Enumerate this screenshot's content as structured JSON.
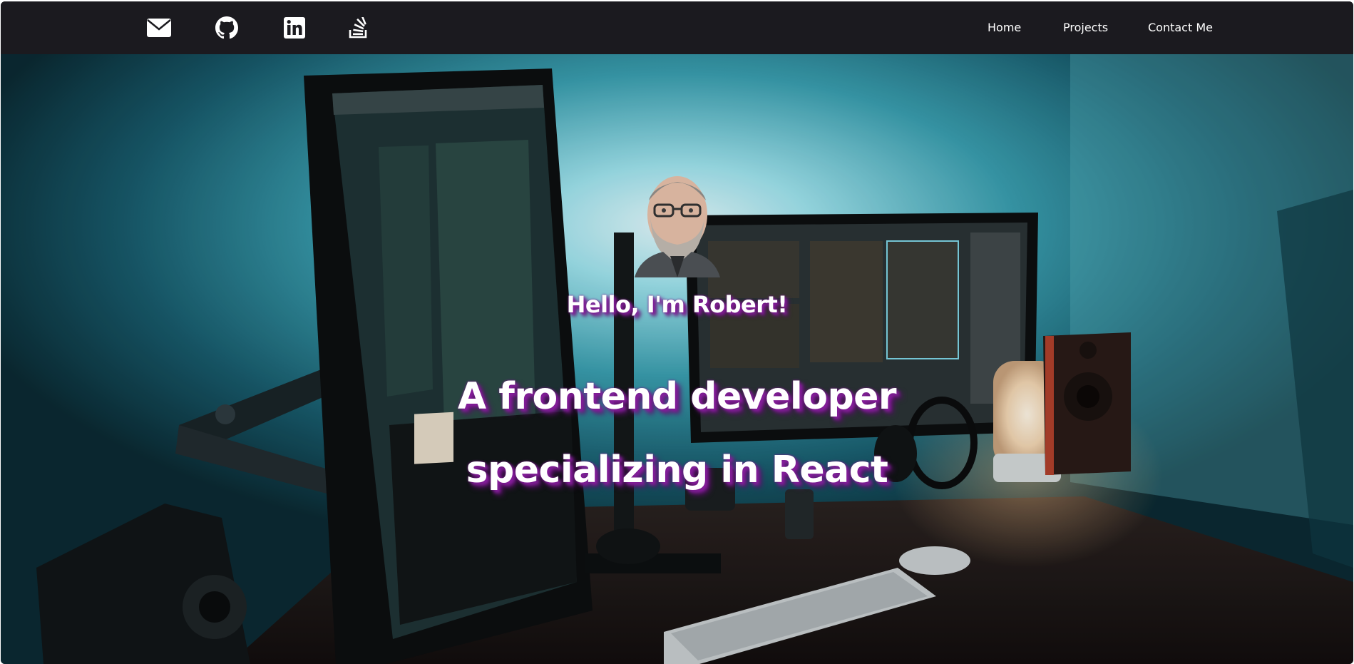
{
  "navbar": {
    "icons": [
      {
        "name": "envelope-icon",
        "label": "Email"
      },
      {
        "name": "github-icon",
        "label": "GitHub"
      },
      {
        "name": "linkedin-icon",
        "label": "LinkedIn"
      },
      {
        "name": "stackoverflow-icon",
        "label": "Stack Overflow"
      }
    ],
    "links": [
      "Home",
      "Projects",
      "Contact Me"
    ]
  },
  "hero": {
    "greeting": "Hello, I'm Robert!",
    "tagline_line1": "A frontend developer",
    "tagline_line2": "specializing in React"
  },
  "colors": {
    "navbar_bg": "#1b1a1f",
    "text": "#ffffff",
    "text_shadow": "#8a1fa0",
    "accent_glow": "#5fd2e0"
  }
}
